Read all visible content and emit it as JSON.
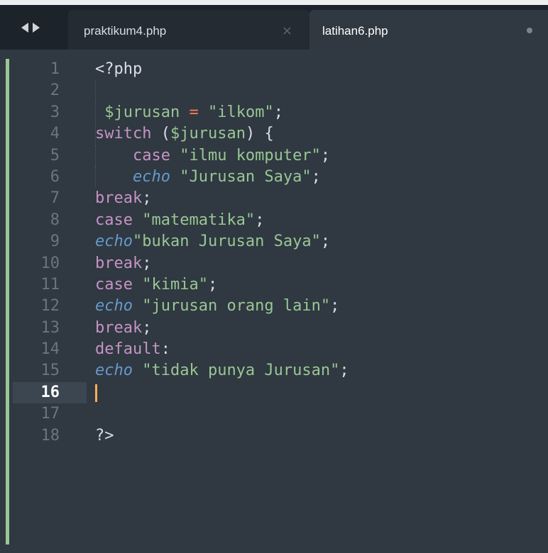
{
  "tabs": [
    {
      "label": "praktikum4.php",
      "close_glyph": "×",
      "active": false
    },
    {
      "label": "latihan6.php",
      "active": true
    }
  ],
  "nav": {
    "back_icon": "arrow-left-icon",
    "forward_icon": "arrow-right-icon"
  },
  "editor": {
    "current_line": 16,
    "line_numbers": [
      "1",
      "2",
      "3",
      "4",
      "5",
      "6",
      "7",
      "8",
      "9",
      "10",
      "11",
      "12",
      "13",
      "14",
      "15",
      "16",
      "17",
      "18"
    ],
    "lines": [
      [
        [
          "t-plain",
          "<?php"
        ]
      ],
      [],
      [
        [
          "t-plain",
          " "
        ],
        [
          "t-var",
          "$jurusan"
        ],
        [
          "t-plain",
          " "
        ],
        [
          "t-op",
          "="
        ],
        [
          "t-plain",
          " "
        ],
        [
          "t-str",
          "\"ilkom\""
        ],
        [
          "t-punct",
          ";"
        ]
      ],
      [
        [
          "t-kw",
          "switch"
        ],
        [
          "t-plain",
          " ("
        ],
        [
          "t-var",
          "$jurusan"
        ],
        [
          "t-plain",
          ") {"
        ]
      ],
      [
        [
          "t-plain",
          "    "
        ],
        [
          "t-kw",
          "case"
        ],
        [
          "t-plain",
          " "
        ],
        [
          "t-str",
          "\"ilmu komputer\""
        ],
        [
          "t-punct",
          ";"
        ]
      ],
      [
        [
          "t-plain",
          "    "
        ],
        [
          "t-fn",
          "echo"
        ],
        [
          "t-plain",
          " "
        ],
        [
          "t-str",
          "\"Jurusan Saya\""
        ],
        [
          "t-punct",
          ";"
        ]
      ],
      [
        [
          "t-kw",
          "break"
        ],
        [
          "t-punct",
          ";"
        ]
      ],
      [
        [
          "t-kw",
          "case"
        ],
        [
          "t-plain",
          " "
        ],
        [
          "t-str",
          "\"matematika\""
        ],
        [
          "t-punct",
          ";"
        ]
      ],
      [
        [
          "t-fn",
          "echo"
        ],
        [
          "t-str",
          "\"bukan Jurusan Saya\""
        ],
        [
          "t-punct",
          ";"
        ]
      ],
      [
        [
          "t-kw",
          "break"
        ],
        [
          "t-punct",
          ";"
        ]
      ],
      [
        [
          "t-kw",
          "case"
        ],
        [
          "t-plain",
          " "
        ],
        [
          "t-str",
          "\"kimia\""
        ],
        [
          "t-punct",
          ";"
        ]
      ],
      [
        [
          "t-fn",
          "echo"
        ],
        [
          "t-plain",
          " "
        ],
        [
          "t-str",
          "\"jurusan orang lain\""
        ],
        [
          "t-punct",
          ";"
        ]
      ],
      [
        [
          "t-kw",
          "break"
        ],
        [
          "t-punct",
          ";"
        ]
      ],
      [
        [
          "t-kw",
          "default"
        ],
        [
          "t-punct",
          ":"
        ]
      ],
      [
        [
          "t-fn",
          "echo"
        ],
        [
          "t-plain",
          " "
        ],
        [
          "t-str",
          "\"tidak punya Jurusan\""
        ],
        [
          "t-punct",
          ";"
        ]
      ],
      [],
      [],
      [
        [
          "t-plain",
          "?>"
        ]
      ]
    ]
  },
  "colors": {
    "background": "#303841",
    "string": "#99c794",
    "keyword": "#c594c5",
    "function": "#6699cc",
    "operator": "#f97b58",
    "caret": "#f9ae58"
  }
}
